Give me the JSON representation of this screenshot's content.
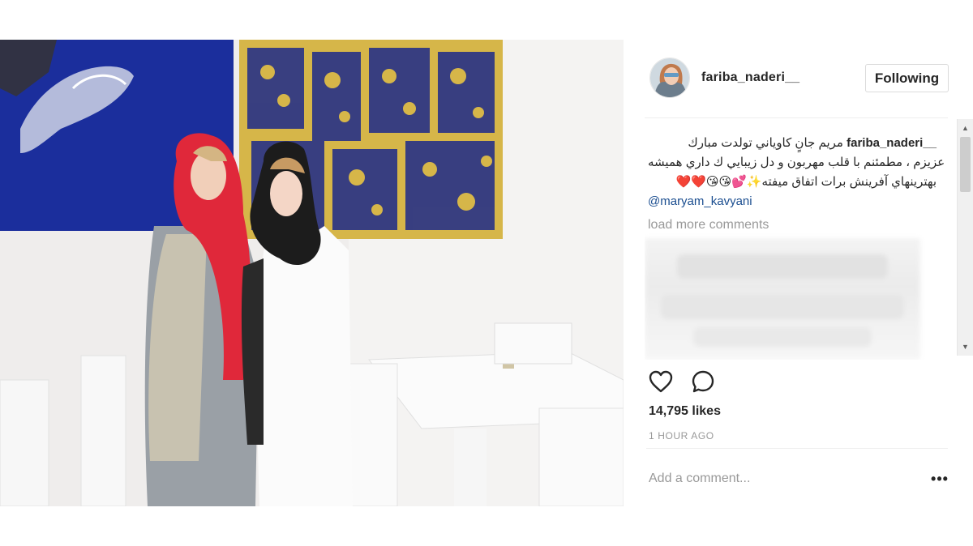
{
  "post": {
    "image_alt": "Two women standing in a white cafe in front of artwork",
    "header": {
      "username": "fariba_naderi__",
      "follow_label": "Following"
    },
    "caption": {
      "username": "fariba_naderi__",
      "line1": "مريم جانٍ كاوياني تولدت مبارك",
      "line2": "عزيزم ، مطمئنم با قلب مهربون و دل زيبايي ك داري هميشه",
      "line3": "بهترينهاي آفرينش برات اتفاق ميفته",
      "emoji_line3_prefix": "💕✨",
      "emoji_line3_suffix": "❤️❤️😘😘",
      "mention": "@maryam_kavyani"
    },
    "load_more_label": "load more comments",
    "likes_text": "14,795 likes",
    "time_text": "1 HOUR AGO",
    "comment_placeholder": "Add a comment...",
    "more_label": "•••"
  },
  "icons": {
    "like": "heart-icon",
    "comment": "comment-bubble-icon",
    "more": "more-options-icon",
    "scroll_up": "scroll-up-arrow-icon",
    "scroll_down": "scroll-down-arrow-icon"
  },
  "colors": {
    "mention": "#1a4d8f",
    "muted": "#999999",
    "text": "#262626",
    "border": "#dbdbdb"
  }
}
